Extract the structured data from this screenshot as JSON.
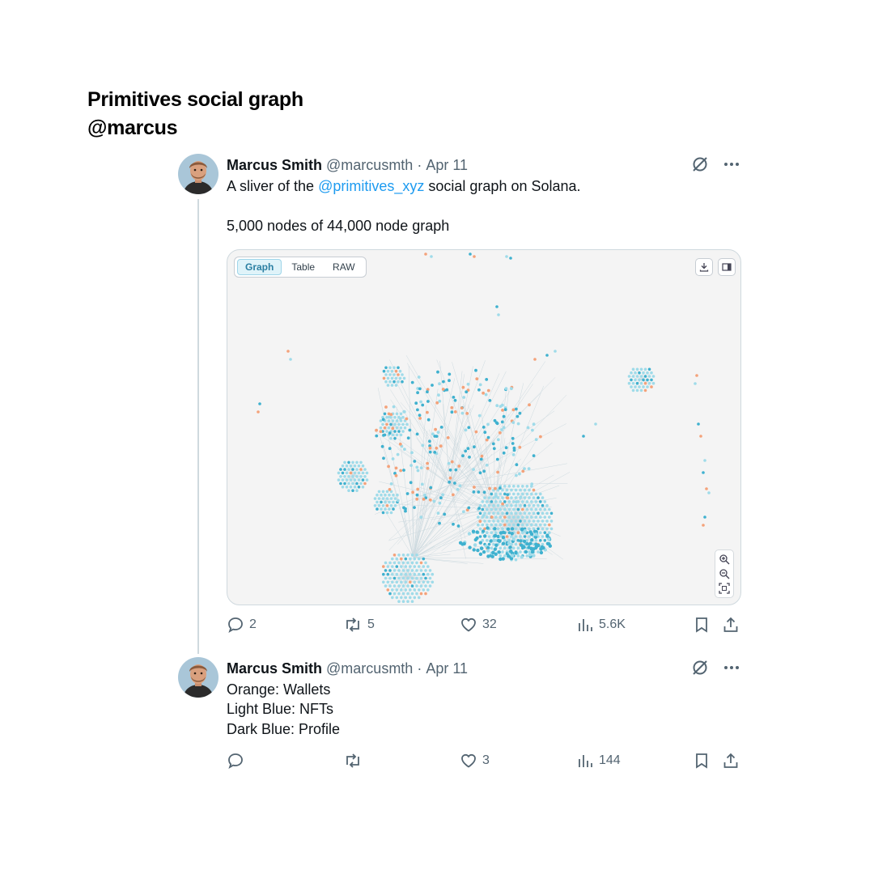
{
  "heading": {
    "title": "Primitives social graph",
    "subtitle": "@marcus"
  },
  "colors": {
    "wallet": "#f4a27a",
    "nft": "#9fdbe9",
    "profile": "#3fb1cf",
    "link": "#1d9bf0",
    "muted": "#536471"
  },
  "tweets": [
    {
      "author": {
        "name": "Marcus Smith",
        "handle": "@marcusmth",
        "separator": "·",
        "date": "Apr 11"
      },
      "text": {
        "line1_prefix": "A sliver of the",
        "mention": "@primitives_xyz",
        "line1_suffix": "social graph on Solana.",
        "line2": "5,000 nodes of 44,000 node graph"
      },
      "media": {
        "tabs": [
          {
            "label": "Graph",
            "active": true
          },
          {
            "label": "Table",
            "active": false
          },
          {
            "label": "RAW",
            "active": false
          }
        ],
        "tools": [
          "download-icon",
          "panel-icon"
        ],
        "zoom_tools": [
          "zoom-in-icon",
          "zoom-out-icon",
          "fit-screen-icon"
        ]
      },
      "stats": {
        "replies": "2",
        "reposts": "5",
        "likes": "32",
        "views": "5.6K"
      }
    },
    {
      "author": {
        "name": "Marcus Smith",
        "handle": "@marcusmth",
        "separator": "·",
        "date": "Apr 11"
      },
      "lines": [
        "Orange: Wallets",
        "Light Blue: NFTs",
        "Dark Blue: Profile"
      ],
      "stats": {
        "replies": "",
        "reposts": "",
        "likes": "3",
        "views": "144"
      }
    }
  ]
}
